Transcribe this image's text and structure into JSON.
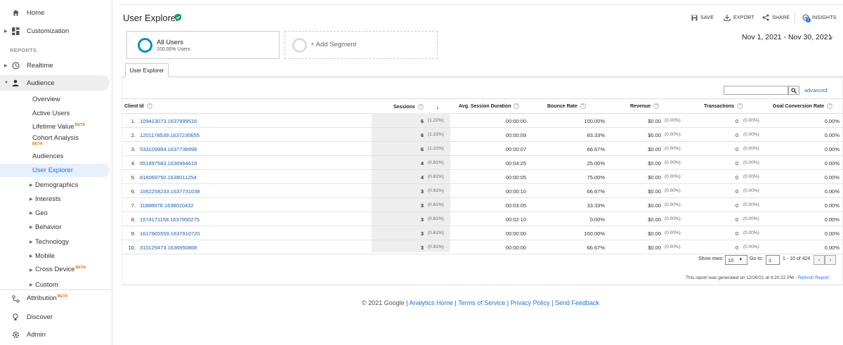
{
  "sidebar": {
    "home": "Home",
    "customization": "Customization",
    "reports_label": "REPORTS",
    "realtime": "Realtime",
    "audience": "Audience",
    "audience_items": [
      {
        "label": "Overview"
      },
      {
        "label": "Active Users"
      },
      {
        "label": "Lifetime Value",
        "badge": "BETA"
      },
      {
        "label": "Cohort Analysis",
        "badge": "BETA"
      },
      {
        "label": "Audiences"
      },
      {
        "label": "User Explorer"
      },
      {
        "label": "Demographics"
      },
      {
        "label": "Interests"
      },
      {
        "label": "Geo"
      },
      {
        "label": "Behavior"
      },
      {
        "label": "Technology"
      },
      {
        "label": "Mobile"
      },
      {
        "label": "Cross Device",
        "badge": "BETA"
      },
      {
        "label": "Custom"
      }
    ],
    "attribution": "Attribution",
    "attribution_badge": "BETA",
    "discover": "Discover",
    "admin": "Admin"
  },
  "header": {
    "title": "User Explorer",
    "save": "SAVE",
    "export": "EXPORT",
    "share": "SHARE",
    "insights": "INSIGHTS",
    "insights_count": "1"
  },
  "segments": {
    "all_users_name": "All Users",
    "all_users_pct": "100.00% Users",
    "add_segment": "+ Add Segment"
  },
  "date_range": "Nov 1, 2021 - Nov 30, 2021",
  "tab_label": "User Explorer",
  "search": {
    "placeholder": "",
    "advanced": "advanced"
  },
  "table": {
    "columns": {
      "client_id": "Client Id",
      "sessions": "Sessions",
      "avg_duration": "Avg. Session Duration",
      "bounce_rate": "Bounce Rate",
      "revenue": "Revenue",
      "transactions": "Transactions",
      "goal_conversion": "Goal Conversion Rate"
    },
    "rows": [
      {
        "idx": "1.",
        "client_id": "109413073.1637999516",
        "sessions": "6",
        "sessions_pct": "(1.22%)",
        "duration": "00:00:00",
        "bounce": "100.00%",
        "revenue": "$0.00",
        "revenue_pct": "(0.00%)",
        "transactions": "0",
        "transactions_pct": "(0.00%)",
        "goal": "0.00%"
      },
      {
        "idx": "2.",
        "client_id": "1201178539.1637230655",
        "sessions": "6",
        "sessions_pct": "(1.22%)",
        "duration": "00:00:09",
        "bounce": "83.33%",
        "revenue": "$0.00",
        "revenue_pct": "(0.00%)",
        "transactions": "0",
        "transactions_pct": "(0.00%)",
        "goal": "0.00%"
      },
      {
        "idx": "3.",
        "client_id": "533109964.1637738998",
        "sessions": "6",
        "sessions_pct": "(1.22%)",
        "duration": "00:00:07",
        "bounce": "66.67%",
        "revenue": "$0.00",
        "revenue_pct": "(0.00%)",
        "transactions": "0",
        "transactions_pct": "(0.00%)",
        "goal": "0.00%"
      },
      {
        "idx": "4.",
        "client_id": "651897583.1636964619",
        "sessions": "4",
        "sessions_pct": "(0.81%)",
        "duration": "00:04:25",
        "bounce": "25.00%",
        "revenue": "$0.00",
        "revenue_pct": "(0.00%)",
        "transactions": "0",
        "transactions_pct": "(0.00%)",
        "goal": "0.00%"
      },
      {
        "idx": "5.",
        "client_id": "818069750.1638011254",
        "sessions": "4",
        "sessions_pct": "(0.81%)",
        "duration": "00:00:05",
        "bounce": "75.00%",
        "revenue": "$0.00",
        "revenue_pct": "(0.00%)",
        "transactions": "0",
        "transactions_pct": "(0.00%)",
        "goal": "0.00%"
      },
      {
        "idx": "6.",
        "client_id": "1062258233.1637731038",
        "sessions": "3",
        "sessions_pct": "(0.61%)",
        "duration": "00:00:10",
        "bounce": "66.67%",
        "revenue": "$0.00",
        "revenue_pct": "(0.00%)",
        "transactions": "0",
        "transactions_pct": "(0.00%)",
        "goal": "0.00%"
      },
      {
        "idx": "7.",
        "client_id": "11888978.1638020432",
        "sessions": "3",
        "sessions_pct": "(0.61%)",
        "duration": "00:03:05",
        "bounce": "33.33%",
        "revenue": "$0.00",
        "revenue_pct": "(0.00%)",
        "transactions": "0",
        "transactions_pct": "(0.00%)",
        "goal": "0.00%"
      },
      {
        "idx": "8.",
        "client_id": "1574171158.1637950275",
        "sessions": "3",
        "sessions_pct": "(0.61%)",
        "duration": "00:02:10",
        "bounce": "0.00%",
        "revenue": "$0.00",
        "revenue_pct": "(0.00%)",
        "transactions": "0",
        "transactions_pct": "(0.00%)",
        "goal": "0.00%"
      },
      {
        "idx": "9.",
        "client_id": "1617965559.1637910720",
        "sessions": "3",
        "sessions_pct": "(0.61%)",
        "duration": "00:00:00",
        "bounce": "100.00%",
        "revenue": "$0.00",
        "revenue_pct": "(0.00%)",
        "transactions": "0",
        "transactions_pct": "(0.00%)",
        "goal": "0.00%"
      },
      {
        "idx": "10.",
        "client_id": "310129473.1636950868",
        "sessions": "3",
        "sessions_pct": "(0.61%)",
        "duration": "00:00:00",
        "bounce": "66.67%",
        "revenue": "$0.00",
        "revenue_pct": "(0.00%)",
        "transactions": "0",
        "transactions_pct": "(0.00%)",
        "goal": "0.00%"
      }
    ]
  },
  "pagination": {
    "show_rows_label": "Show rows:",
    "show_rows_value": "10",
    "goto_label": "Go to:",
    "goto_value": "1",
    "range": "1 - 10 of 424",
    "prev": "‹",
    "next": "›"
  },
  "generated_note": "This report was generated on 12/26/21 at 4:20:22 PM - ",
  "refresh_link": "Refresh Report",
  "footer": {
    "copyright": "© 2021 Google | ",
    "analytics_home": "Analytics Home",
    "sep": " | ",
    "terms": "Terms of Service",
    "privacy": "Privacy Policy",
    "feedback": "Send Feedback"
  },
  "colors": {
    "accent": "#1a73e8",
    "link": "#1a5fb4",
    "segment": "#058dc7",
    "beta": "#e8710a",
    "verified": "#0f9d58"
  }
}
